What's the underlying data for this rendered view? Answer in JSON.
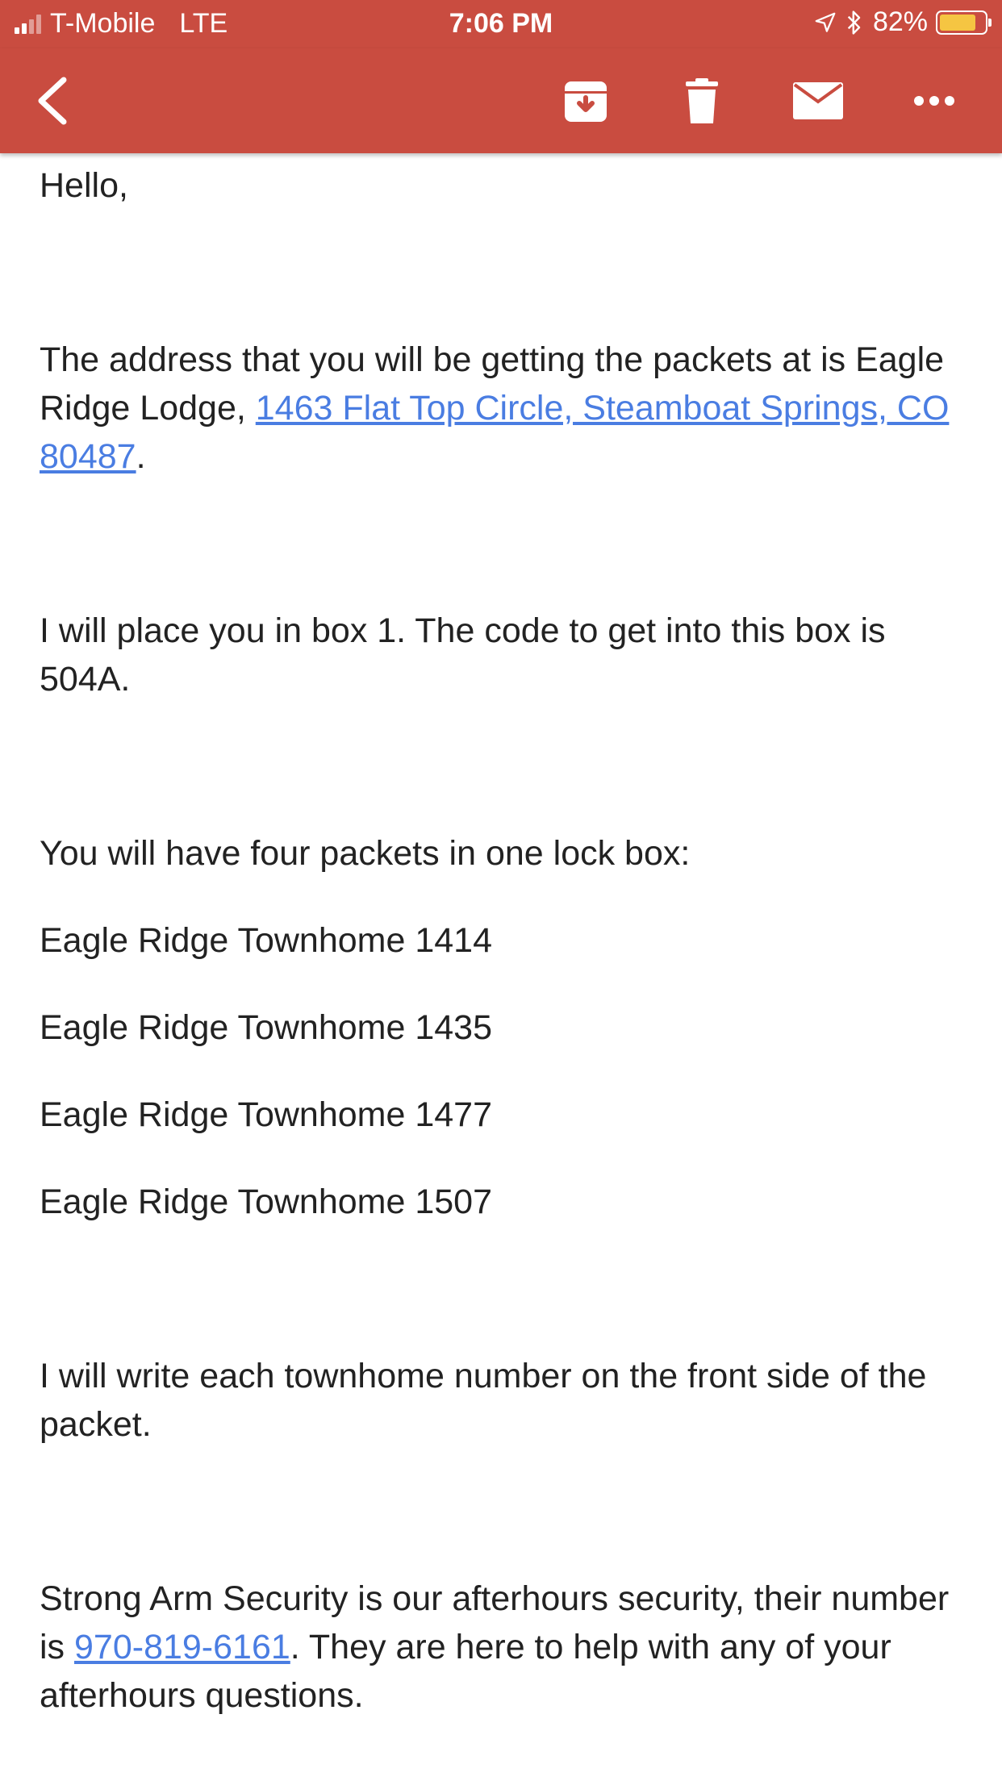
{
  "status_bar": {
    "carrier": "T-Mobile",
    "network": "LTE",
    "time": "7:06 PM",
    "battery": "82%",
    "battery_level": 0.82,
    "icons": [
      "signal-icon",
      "location-icon",
      "bluetooth-icon",
      "battery-icon"
    ]
  },
  "toolbar": {
    "background_color": "#c94c40",
    "icons": [
      "back-icon",
      "archive-icon",
      "trash-icon",
      "mail-icon",
      "more-icon"
    ]
  },
  "email": {
    "greeting": "Hello,",
    "p1_text": "The address that you will be getting the packets at is Eagle Ridge Lodge, ",
    "p1_link": "1463 Flat Top Circle, Steamboat Springs, CO 80487",
    "p1_end": ".",
    "p2": "I will place you in box 1. The code to get into this box is 504A.",
    "p3": "You will have four packets in one lock box:",
    "packets": [
      "Eagle Ridge Townhome 1414",
      "Eagle Ridge Townhome 1435",
      "Eagle Ridge Townhome 1477",
      "Eagle Ridge Townhome 1507"
    ],
    "p4": "I will write each townhome number on the front side of the packet.",
    "p5_text": "Strong Arm Security is our afterhours security, their number is ",
    "p5_link": "970-819-6161",
    "p5_end": ". They are here to help with any of your afterhours questions.",
    "link_color": "#4a7de2"
  }
}
